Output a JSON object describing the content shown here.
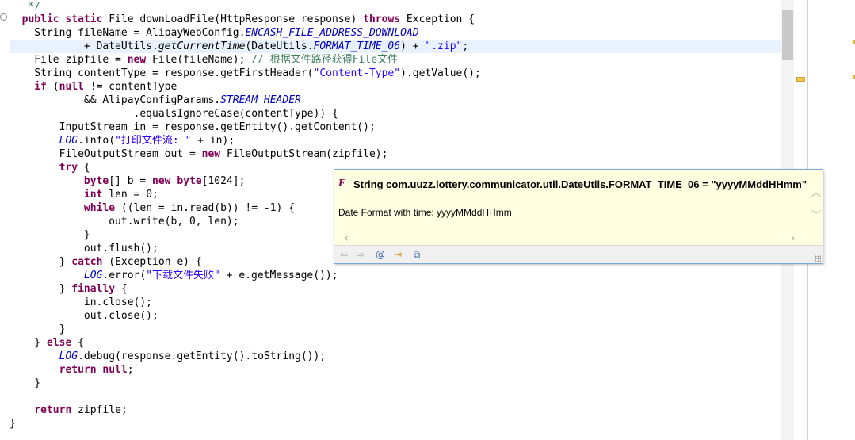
{
  "editor": {
    "lines": {
      "l1": "   */",
      "l2a": "public static",
      "l2b": " File downLoadFile(HttpResponse response) ",
      "l2c": "throws",
      "l2d": " Exception {",
      "l3a": "    String fileName = AlipayWebConfig.",
      "l3b": "ENCASH_FILE_ADDRESS_DOWNLOAD",
      "l4a": "            + DateUtils.",
      "l4b": "getCurrentTime",
      "l4c": "(DateUtils.",
      "l4d": "FORMAT_TIME_06",
      "l4e": ") + ",
      "l4f": "\".zip\"",
      "l4g": ";",
      "l5a": "    File zipfile = ",
      "l5b": "new",
      "l5c": " File(fileName); ",
      "l5d": "// 根据文件路径获得File文件",
      "l6a": "    String contentType = response.getFirstHeader(",
      "l6b": "\"Content-Type\"",
      "l6c": ").getValue();",
      "l7a": "    if",
      "l7b": " (",
      "l7c": "null",
      "l7d": " != contentType",
      "l8a": "            && AlipayConfigParams.",
      "l8b": "STREAM_HEADER",
      "l9": "                    .equalsIgnoreCase(contentType)) {",
      "l10": "        InputStream in = response.getEntity().getContent();",
      "l11a": "        LOG",
      "l11b": ".info(",
      "l11c": "\"打印文件流: \"",
      "l11d": " + in);",
      "l12a": "        FileOutputStream out = ",
      "l12b": "new",
      "l12c": " FileOutputStream(zipfile);",
      "l13a": "        try",
      "l13b": " {",
      "l14a": "            byte",
      "l14b": "[] b = ",
      "l14c": "new",
      "l14d": " ",
      "l14e": "byte",
      "l14f": "[1024];",
      "l15a": "            int",
      "l15b": " len = 0;",
      "l16a": "            while",
      "l16b": " ((len = in.read(b)) != -1) {",
      "l17": "                out.write(b, 0, len);",
      "l18": "            }",
      "l19": "            out.flush();",
      "l20a": "        } ",
      "l20b": "catch",
      "l20c": " (Exception e) {",
      "l21a": "            LOG",
      "l21b": ".error(",
      "l21c": "\"下载文件失败\"",
      "l21d": " + e.getMessage());",
      "l22a": "        } ",
      "l22b": "finally",
      "l22c": " {",
      "l23": "            in.close();",
      "l24": "            out.close();",
      "l25": "        }",
      "l26a": "    } ",
      "l26b": "else",
      "l26c": " {",
      "l27a": "        LOG",
      "l27b": ".debug(response.getEntity().toString());",
      "l28a": "        return",
      "l28b": " ",
      "l28c": "null",
      "l28d": ";",
      "l29": "    }",
      "l30": "",
      "l31a": "    return",
      "l31b": " zipfile;",
      "l32": "}"
    },
    "fold_symbol": "−"
  },
  "popup": {
    "icon": "field-static-icon",
    "title": "String com.uuzz.lottery.communicator.util.DateUtils.FORMAT_TIME_06 = \"yyyyMMddHHmm\"",
    "description": "Date Format with time: yyyyMMddHHmm",
    "toolbar": {
      "back_icon": "back-arrow-icon",
      "forward_icon": "forward-arrow-icon",
      "javadoc_icon": "at-sign-icon",
      "open_declaration_icon": "open-declaration-icon",
      "open_external_icon": "open-external-icon"
    }
  },
  "colors": {
    "keyword": "#7f0055",
    "string": "#2a00ff",
    "field": "#0000c0",
    "comment": "#3f7f5f",
    "current_line": "#e8f2fe",
    "popup_bg": "#ffffe1"
  }
}
